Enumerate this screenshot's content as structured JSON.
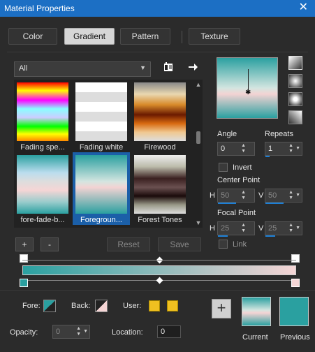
{
  "window": {
    "title": "Material Properties",
    "close_glyph": "✕"
  },
  "tabs": [
    {
      "label": "Color"
    },
    {
      "label": "Gradient"
    },
    {
      "label": "Pattern"
    },
    {
      "label": "Texture"
    }
  ],
  "library": {
    "category": "All",
    "items": [
      {
        "label": "Fading spe..."
      },
      {
        "label": "Fading white"
      },
      {
        "label": "Firewood"
      },
      {
        "label": "fore-fade-b..."
      },
      {
        "label": "Foregroun...",
        "selected": true
      },
      {
        "label": "Forest Tones"
      }
    ]
  },
  "buttons": {
    "add": "+",
    "remove": "-",
    "reset": "Reset",
    "save": "Save"
  },
  "angle": {
    "label": "Angle",
    "value": "0"
  },
  "repeats": {
    "label": "Repeats",
    "value": "1"
  },
  "invert": {
    "label": "Invert",
    "checked": false
  },
  "center_point": {
    "label": "Center Point",
    "h_label": "H",
    "h_value": "50",
    "v_label": "V",
    "v_value": "50"
  },
  "focal_point": {
    "label": "Focal Point",
    "h_label": "H",
    "h_value": "25",
    "v_label": "V",
    "v_value": "25"
  },
  "link": {
    "label": "Link"
  },
  "bottom": {
    "fore_label": "Fore:",
    "back_label": "Back:",
    "user_label": "User:",
    "opacity_label": "Opacity:",
    "opacity_value": "0",
    "location_label": "Location:",
    "location_value": "0",
    "current_label": "Current",
    "previous_label": "Previous"
  },
  "colors": {
    "accent": "#1c6fc4",
    "teal": "#2aa0a0",
    "pink": "#f5d5d5",
    "user": "#f0c020"
  }
}
